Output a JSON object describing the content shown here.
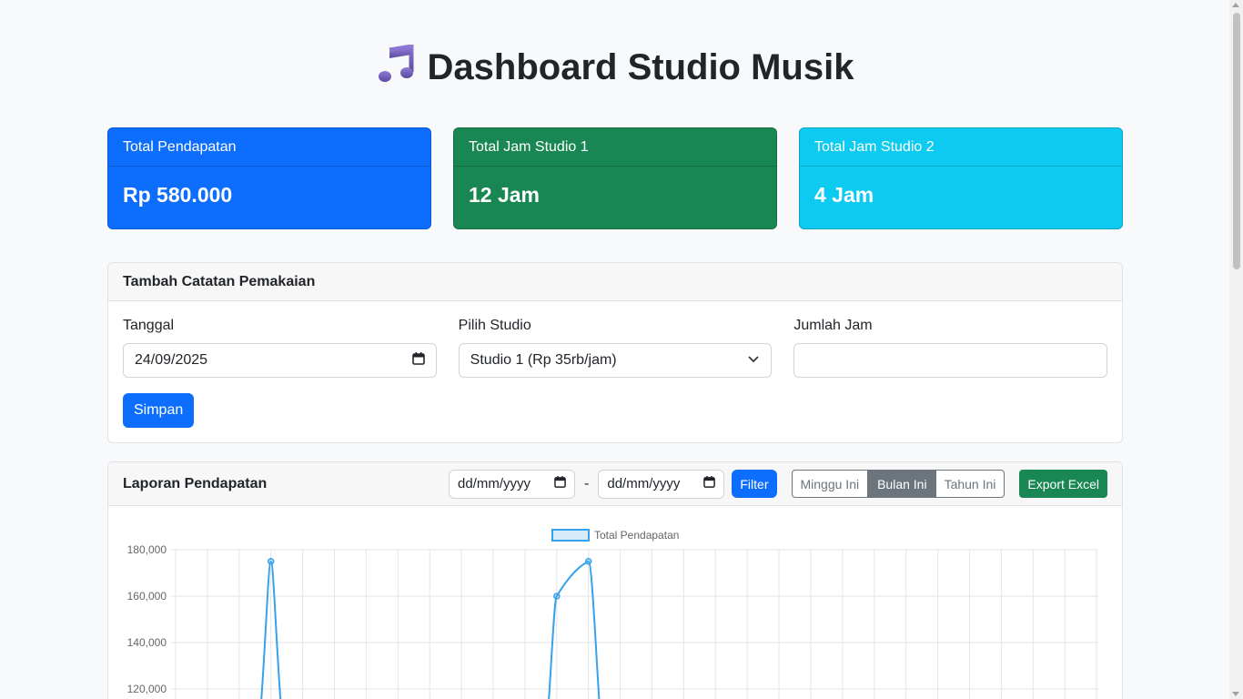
{
  "header": {
    "title": "Dashboard Studio Musik",
    "icon": "music-note-icon"
  },
  "stats": [
    {
      "label": "Total Pendapatan",
      "value": "Rp 580.000",
      "color": "#0d6efd"
    },
    {
      "label": "Total Jam Studio 1",
      "value": "12 Jam",
      "color": "#198754"
    },
    {
      "label": "Total Jam Studio 2",
      "value": "4 Jam",
      "color": "#0dcaf0"
    }
  ],
  "form": {
    "title": "Tambah Catatan Pemakaian",
    "date_label": "Tanggal",
    "date_value": "24/09/2025",
    "studio_label": "Pilih Studio",
    "studio_value": "Studio 1 (Rp 35rb/jam)",
    "hours_label": "Jumlah Jam",
    "hours_value": "",
    "save_label": "Simpan"
  },
  "report": {
    "title": "Laporan Pendapatan",
    "start_placeholder": "dd/mm/yyyy",
    "separator": "-",
    "end_placeholder": "dd/mm/yyyy",
    "filter_label": "Filter",
    "ranges": [
      "Minggu Ini",
      "Bulan Ini",
      "Tahun Ini"
    ],
    "active_range": "Bulan Ini",
    "export_label": "Export Excel"
  },
  "chart_data": {
    "type": "line",
    "legend": "Total Pendapatan",
    "y_ticks": [
      "180,000",
      "160,000",
      "140,000",
      "120,000"
    ],
    "ylim": [
      120000,
      180000
    ],
    "points": [
      {
        "index": 3,
        "value": 175000
      },
      {
        "index": 12,
        "value": 160000
      },
      {
        "index": 13,
        "value": 175000
      }
    ],
    "line_color": "#36a2eb",
    "grid": true
  }
}
